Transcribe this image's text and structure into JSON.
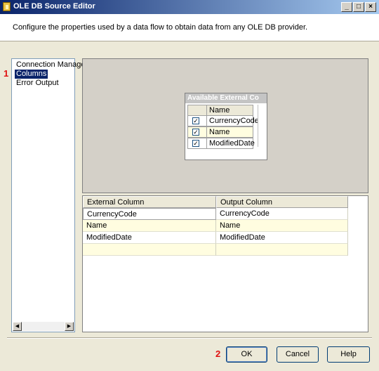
{
  "window": {
    "title": "OLE DB Source Editor",
    "minimize": "_",
    "maximize": "□",
    "close": "×"
  },
  "description": "Configure the properties used by a data flow to obtain data from any OLE DB provider.",
  "nav": {
    "items": [
      {
        "label": "Connection Manager",
        "selected": false
      },
      {
        "label": "Columns",
        "selected": true
      },
      {
        "label": "Error Output",
        "selected": false
      }
    ],
    "scroll_left": "◀",
    "scroll_right": "▶"
  },
  "markers": {
    "first": "1",
    "second": "2"
  },
  "available_columns": {
    "title": "Available External Co",
    "header": "Name",
    "rows": [
      {
        "name": "CurrencyCode",
        "checked": true
      },
      {
        "name": "Name",
        "checked": true
      },
      {
        "name": "ModifiedDate",
        "checked": true
      }
    ],
    "check_glyph": "✓"
  },
  "mapping": {
    "headers": [
      "External Column",
      "Output Column"
    ],
    "rows": [
      [
        "CurrencyCode",
        "CurrencyCode"
      ],
      [
        "Name",
        "Name"
      ],
      [
        "ModifiedDate",
        "ModifiedDate"
      ],
      [
        "",
        ""
      ]
    ]
  },
  "buttons": {
    "ok": "OK",
    "cancel": "Cancel",
    "help": "Help"
  }
}
